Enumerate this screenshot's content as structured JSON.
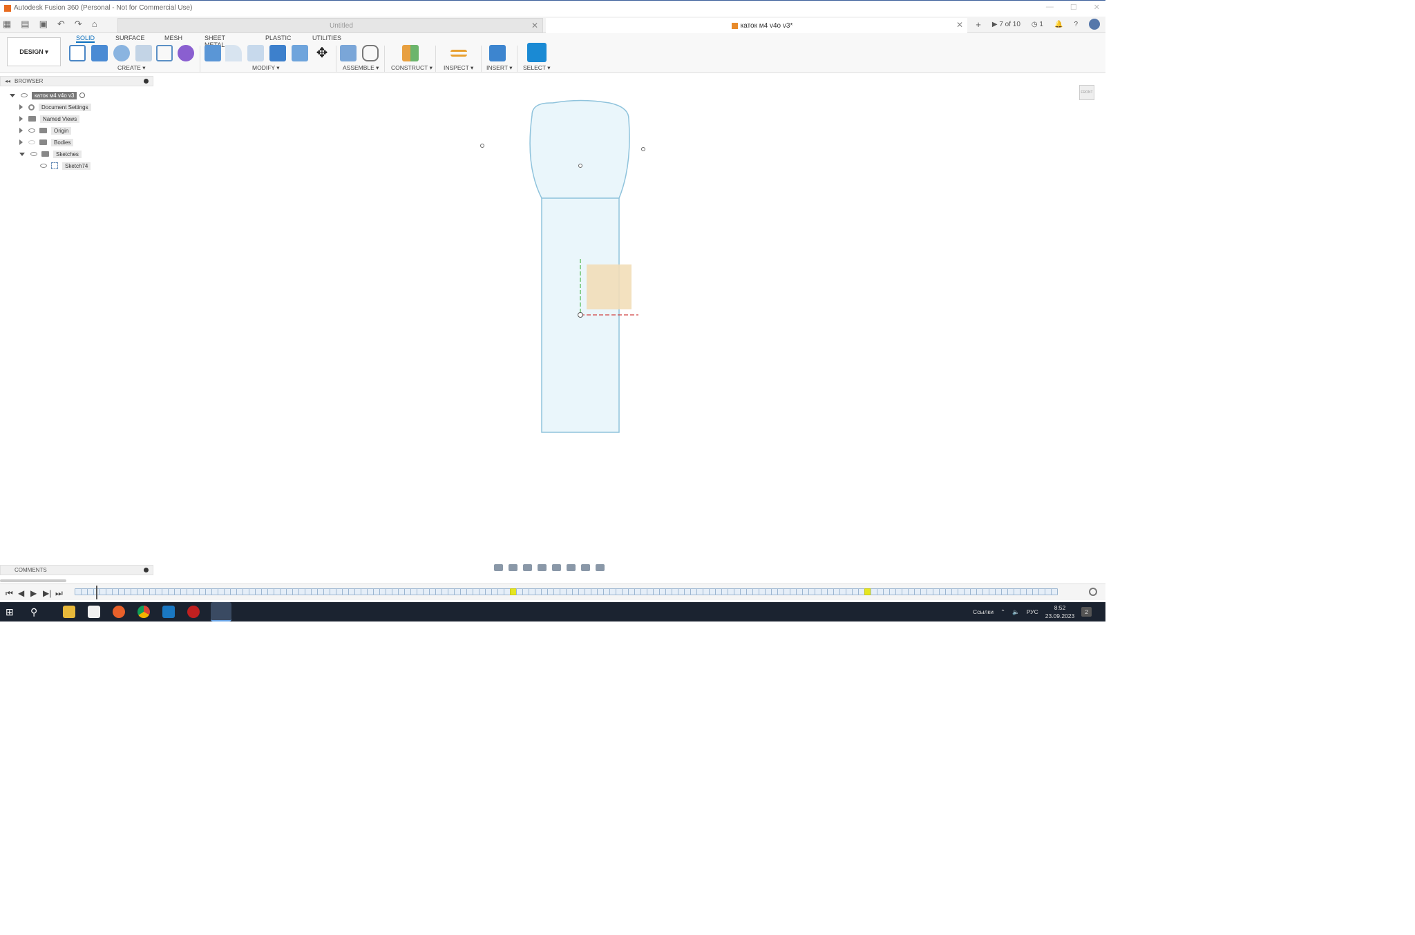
{
  "window": {
    "title": "Autodesk Fusion 360 (Personal - Not for Commercial Use)"
  },
  "tabs": {
    "inactive_label": "Untitled",
    "active_label": "каток м4 v4o v3*",
    "job_status": "7 of 10",
    "clock_count": "1"
  },
  "toolbar": {
    "workspace_label": "DESIGN ▾",
    "ribbon_tabs": [
      "SOLID",
      "SURFACE",
      "MESH",
      "SHEET METAL",
      "PLASTIC",
      "UTILITIES"
    ],
    "groups": [
      "CREATE ▾",
      "MODIFY ▾",
      "ASSEMBLE ▾",
      "CONSTRUCT ▾",
      "INSPECT ▾",
      "INSERT ▾",
      "SELECT ▾"
    ]
  },
  "browser": {
    "header": "BROWSER",
    "root": "каток м4 v4o v3",
    "items": [
      "Document Settings",
      "Named Views",
      "Origin",
      "Bodies",
      "Sketches",
      "Sketch74"
    ]
  },
  "viewcube": {
    "label": "FRONT"
  },
  "comments": {
    "header": "COMMENTS"
  },
  "taskbar": {
    "language_bar": "Ссылки",
    "input_lang": "РУС",
    "time": "8:52",
    "date": "23.09.2023",
    "notification_count": "2"
  },
  "colors": {
    "accent": "#0a6ebd",
    "sketch_fill": "#eaf6fb",
    "sketch_stroke": "#8fc3dc",
    "selected_face": "#f2deb8",
    "taskbar": "#1b2330"
  }
}
